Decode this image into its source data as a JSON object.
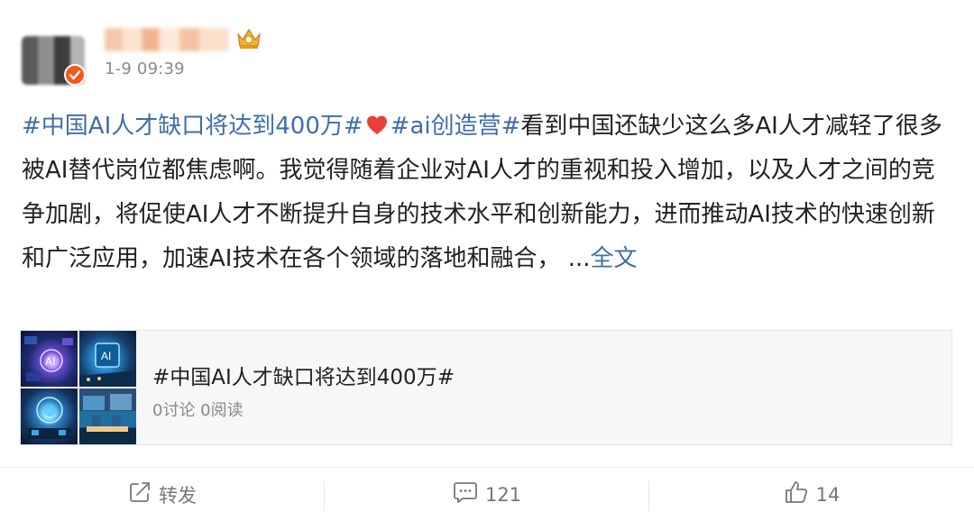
{
  "header": {
    "timestamp": "1-9 09:39"
  },
  "post": {
    "segments": [
      {
        "type": "hashtag",
        "text": "#中国AI人才缺口将达到400万#"
      },
      {
        "type": "icon",
        "icon": "heart-icon",
        "color": "#e8413b"
      },
      {
        "type": "hashtag",
        "text": "#ai创造营#"
      },
      {
        "type": "text",
        "text": "看到中国还缺少这么多AI人才减轻了很多被AI替代岗位都焦虑啊。我觉得随着企业对AI人才的重视和投入增加，以及人才之间的竞争加剧，将促使AI人才不断提升自身的技术水平和创新能力，进而推动AI技术的快速创新和广泛应用，加速AI技术在各个领域的落地和融合，  ..."
      },
      {
        "type": "link",
        "text": "全文"
      }
    ]
  },
  "card": {
    "title": "#中国AI人才缺口将达到400万#",
    "stats": "0讨论 0阅读"
  },
  "actions": {
    "repost_label": "转发",
    "comment_count": "121",
    "like_count": "14"
  },
  "colors": {
    "link": "#3e6fa8",
    "verified": "#f15a1c",
    "heart": "#e8413b"
  }
}
